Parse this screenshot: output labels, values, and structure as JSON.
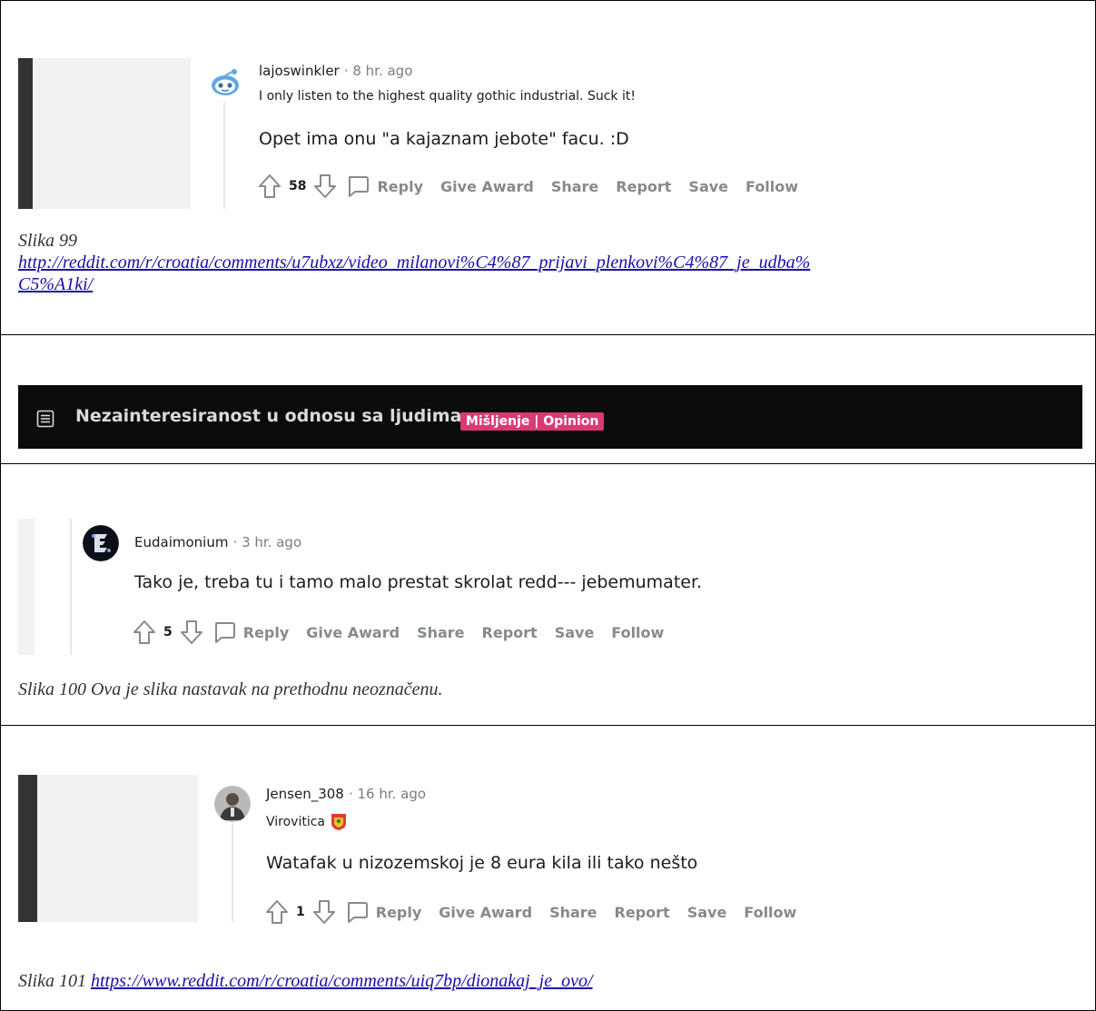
{
  "comments": [
    {
      "username": "lajoswinkler",
      "time": "· 8 hr. ago",
      "flair": "I only listen to the highest quality gothic industrial. Suck it!",
      "body": "Opet ima onu \"a kajaznam jebote\" facu. :D",
      "score": "58",
      "avatar": "reddit-snoo-avatar"
    },
    {
      "username": "Eudaimonium",
      "time": "· 3 hr. ago",
      "flair": "",
      "body": "Tako je, treba tu i tamo malo prestat skrolat redd--- jebemumater.",
      "score": "5",
      "avatar": "dark-emblem-avatar"
    },
    {
      "username": "Jensen_308",
      "time": "· 16 hr. ago",
      "flair": "Virovitica",
      "body": "Watafak u nizozemskoj je 8 eura kila ili tako nešto",
      "score": "1",
      "avatar": "photo-avatar"
    }
  ],
  "actions": {
    "reply": "Reply",
    "give_award": "Give Award",
    "share": "Share",
    "report": "Report",
    "save": "Save",
    "follow": "Follow"
  },
  "captions": {
    "c99_label": "Slika 99",
    "c99_link": "http://reddit.com/r/croatia/comments/u7ubxz/video_milanovi%C4%87_prijavi_plenkovi%C4%87_je_udba%C5%A1ki/",
    "c99_link_line1": "http://reddit.com/r/croatia/comments/u7ubxz/video_milanovi%C4%87_prijavi_plenkovi%C4%87_je_udba%",
    "c99_link_line2": "C5%A1ki/",
    "c100_text": "Slika 100 Ova je slika nastavak na prethodnu neoznačenu.",
    "c101_label": "Slika 101",
    "c101_link": "https://www.reddit.com/r/croatia/comments/uiq7bp/dionakaj_je_ovo/"
  },
  "banner": {
    "title": "Nezainteresiranost u odnosu sa ljudima",
    "tag": "Mišljenje | Opinion",
    "tag_color": "#d93a73",
    "icon": "post-text-icon"
  },
  "colors": {
    "action_gray": "#878a8c",
    "link_blue": "#1a0dab"
  }
}
